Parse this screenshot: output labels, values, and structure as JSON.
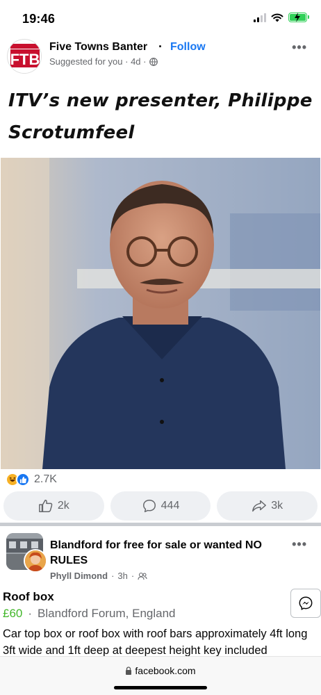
{
  "status_bar": {
    "time": "19:46"
  },
  "post1": {
    "logo_text": "FTB",
    "logo_banner": "FIVE TOWNS BANTER",
    "page_name": "Five Towns Banter",
    "dot": "·",
    "follow_label": "Follow",
    "meta": "Suggested for you · 4d ·",
    "more_label": "•••",
    "text": "ITV’s new presenter, Philippe Scrotumfeel",
    "reaction_count": "2.7K",
    "like_count": "2k",
    "comment_count": "444",
    "share_count": "3k"
  },
  "post2": {
    "group_name": "Blandford for free for sale or wanted NO RULES",
    "author": "Phyll Dimond",
    "time": "3h",
    "more_label": "•••",
    "title": "Roof box",
    "price": "£60",
    "price_sep": "·",
    "location": "Blandford Forum, England",
    "description": "Car top box or roof box with roof bars approximately 4ft long 3ft wide and 1ft deep at deepest height key included"
  },
  "browser": {
    "url": "facebook.com"
  },
  "colors": {
    "accent": "#1877f2",
    "price": "#42b72a",
    "secondary_text": "#65676b"
  },
  "icons": [
    "wifi-icon",
    "battery-icon",
    "globe-icon",
    "haha-icon",
    "like-reaction-icon",
    "thumbs-up-icon",
    "comment-icon",
    "share-icon",
    "friends-icon",
    "messenger-icon",
    "lock-icon"
  ]
}
